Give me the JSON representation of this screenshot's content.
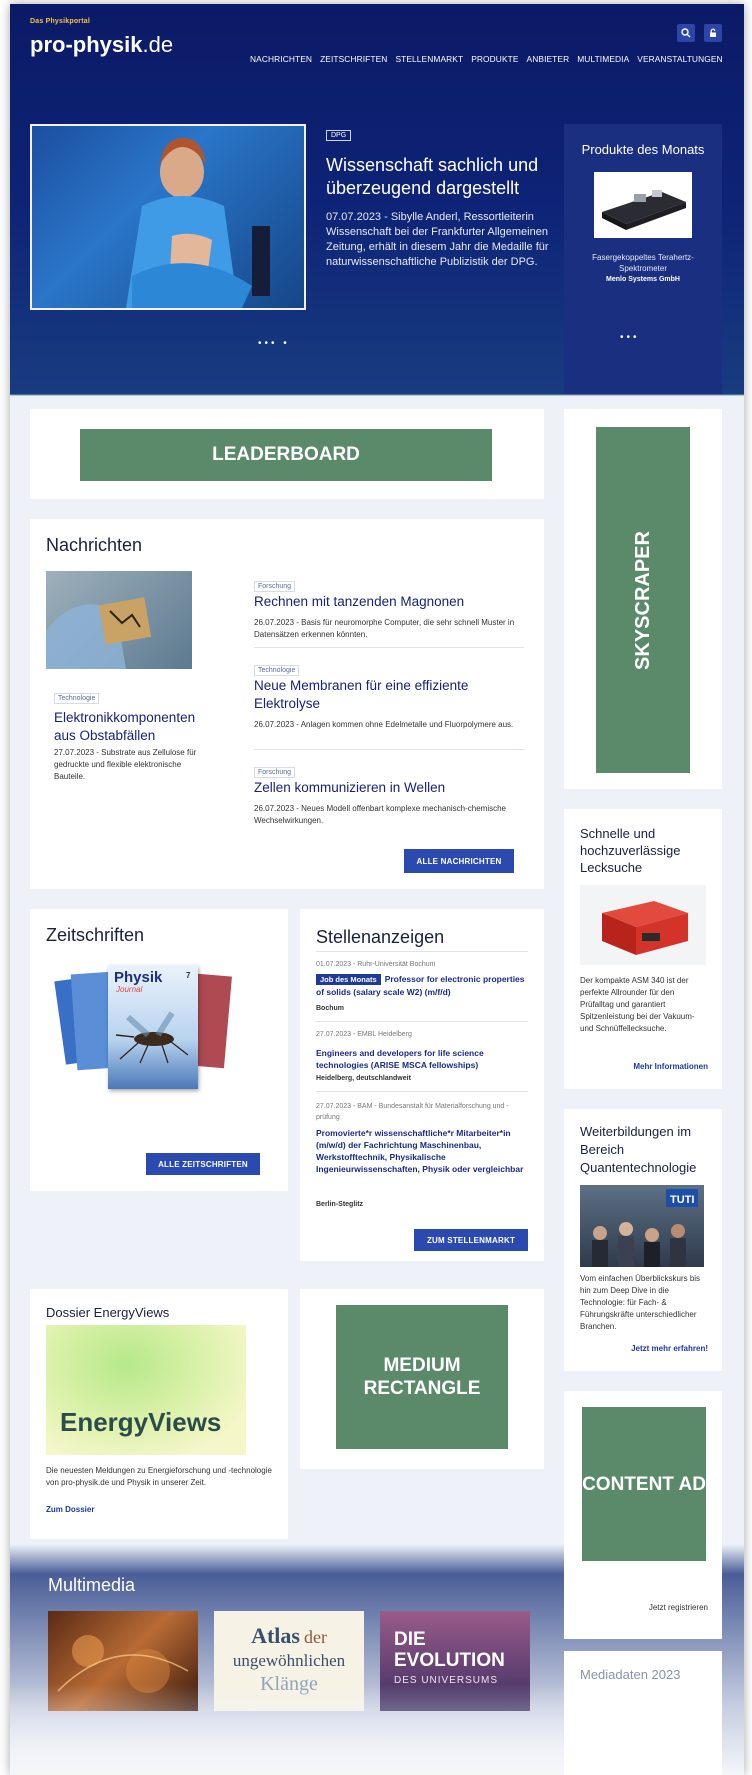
{
  "header": {
    "portal_label": "Das Physikportal",
    "logo_main": "pro-physik",
    "logo_tld": ".de",
    "nav": [
      "NACHRICHTEN",
      "ZEITSCHRIFTEN",
      "STELLENMARKT",
      "PRODUKTE",
      "ANBIETER",
      "MULTIMEDIA",
      "VERANSTALTUNGEN"
    ]
  },
  "hero": {
    "badge": "DPG",
    "title": "Wissenschaft sachlich und überzeugend dargestellt",
    "text": "07.07.2023 - Sibylle Anderl, Ressortleiterin Wissenschaft bei der Frankfurter Allgemeinen Zeitung, erhält in diesem Jahr die Medaille für naturwissenschaftliche Publizistik der DPG.",
    "dots": "••• •"
  },
  "products": {
    "title": "Produkte des Monats",
    "name": "Fasergekoppeltes Terahertz-Spektrometer",
    "vendor": "Menlo Systems GmbH",
    "dots": "•••"
  },
  "ads": {
    "leaderboard": "LEADERBOARD",
    "skyscraper": "SKYSCRAPER",
    "medium": "MEDIUM RECTANGLE",
    "content": "CONTENT AD"
  },
  "news": {
    "heading": "Nachrichten",
    "lead": {
      "tag": "Technologie",
      "title": "Elektronikkomponenten aus Obstabfällen",
      "text": "27.07.2023 - Substrate aus Zellulose für gedruckte und flexible elektronische Bauteile."
    },
    "items": [
      {
        "tag": "Forschung",
        "title": "Rechnen mit tanzenden Magnonen",
        "text": "26.07.2023 - Basis für neuromorphe Computer, die sehr schnell Muster in Datensätzen erkennen könnten."
      },
      {
        "tag": "Technologie",
        "title": "Neue Membranen für eine effiziente Elektrolyse",
        "text": "26.07.2023 - Anlagen kommen ohne Edelmetalle und Fluorpolymere aus."
      },
      {
        "tag": "Forschung",
        "title": "Zellen kommunizieren in Wellen",
        "text": "26.07.2023 - Neues Modell offenbart komplexe mechanisch-chemische Wechselwirkungen."
      }
    ],
    "button": "ALLE NACHRICHTEN"
  },
  "journals": {
    "heading": "Zeitschriften",
    "cover_title": "Physik",
    "cover_sub": "Journal",
    "cover_num": "7",
    "button": "ALLE ZEITSCHRIFTEN"
  },
  "jobs": {
    "heading": "Stellenanzeigen",
    "items": [
      {
        "meta": "01.07.2023 - Ruhr-Universität Bochum",
        "badge": "Job des Monats",
        "title": "Professor for electronic properties of solids (salary scale W2) (m/f/d)",
        "place": "Bochum"
      },
      {
        "meta": "27.07.2023 - EMBL Heidelberg",
        "badge": "",
        "title": "Engineers and developers for life science technologies (ARISE MSCA fellowships)",
        "place": "Heidelberg, deutschlandweit"
      },
      {
        "meta": "27.07.2023 - BAM - Bundesanstalt für Materialforschung und -prüfung",
        "badge": "",
        "title": "Promovierte*r wissenschaftliche*r Mitarbeiter*in (m/w/d) der Fachrichtung Maschinenbau, Werkstofftechnik, Physikalische Ingenieurwissenschaften, Physik oder vergleichbar",
        "place": "Berlin-Steglitz"
      }
    ],
    "button": "ZUM STELLENMARKT"
  },
  "leak": {
    "title": "Schnelle und hochzuverlässige Lecksuche",
    "text": "Der kompakte ASM 340 ist der perfekte Allrounder für den Prüfalltag und garantiert Spitzenleistung bei der Vakuum- und Schnüffellecksuche.",
    "link": "Mehr Informationen"
  },
  "quantum": {
    "title": "Weiterbildungen im Bereich Quantentechnologie",
    "text": "Vom einfachen Überblickskurs bis hin zum Deep Dive in die Technologie: für Fach- & Führungskräfte unterschiedlicher Branchen.",
    "link": "Jetzt mehr erfahren!"
  },
  "dossier": {
    "heading": "Dossier EnergyViews",
    "logo_text": "EnergyViews",
    "text": "Die neuesten Meldungen zu Energieforschung und -technologie von pro-physik.de und Physik in unserer Zeit.",
    "link": "Zum Dossier"
  },
  "multimedia": {
    "heading": "Multimedia",
    "atlas": [
      "Atlas",
      "der",
      "ungewöhnlichen",
      "Klänge"
    ],
    "evolution": [
      "DIE",
      "EVOLUTION",
      "DES UNIVERSUMS"
    ]
  },
  "register": {
    "link": "Jetzt registrieren"
  },
  "mediadaten": {
    "title": "Mediadaten 2023"
  }
}
